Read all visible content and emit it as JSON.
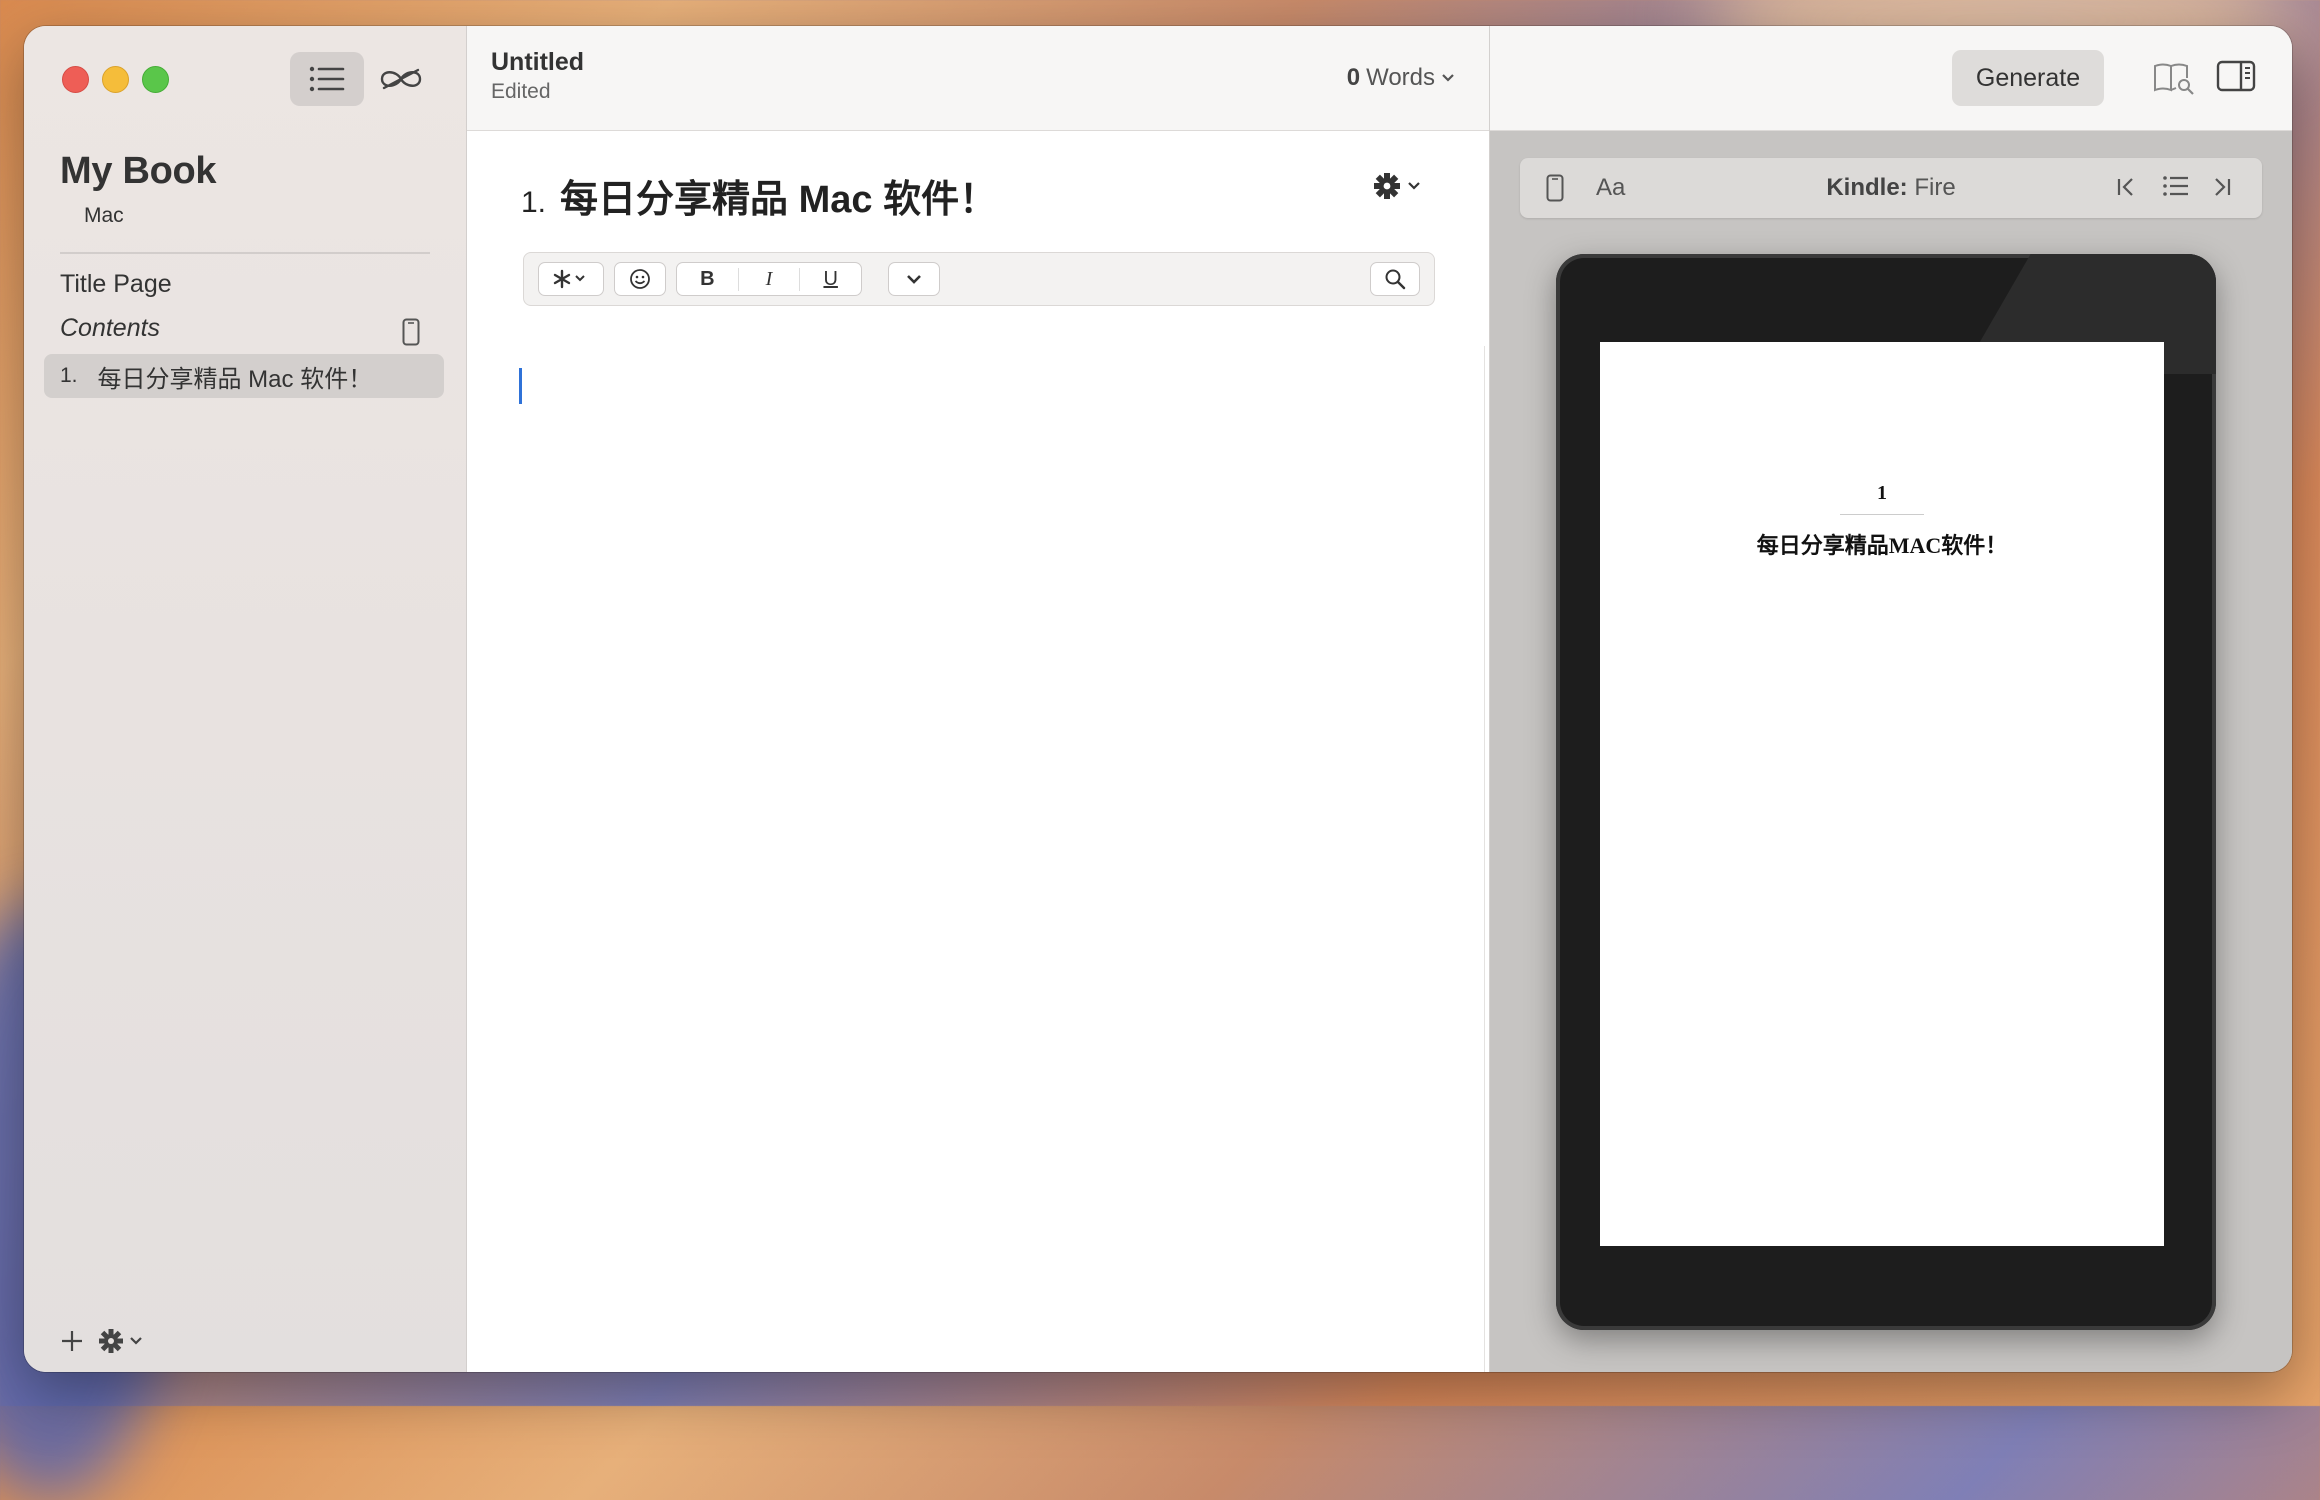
{
  "sidebar": {
    "book_title": "My Book",
    "book_author": "Mac",
    "title_page": "Title Page",
    "contents": "Contents",
    "chapters": [
      {
        "number": "1.",
        "title": "每日分享精品 Mac 软件！"
      }
    ]
  },
  "editor": {
    "doc_title": "Untitled",
    "doc_status": "Edited",
    "word_count": "0",
    "word_label": "Words",
    "chapter_number": "1.",
    "chapter_title": "每日分享精品 Mac 软件！",
    "format_bold": "B",
    "format_italic": "I",
    "format_underline": "U"
  },
  "preview": {
    "generate_label": "Generate",
    "font_label": "Aa",
    "device_brand": "Kindle:",
    "device_model": "Fire",
    "page_chapter_number": "1",
    "page_chapter_title": "每日分享精品MAC软件！"
  },
  "colors": {
    "accent_cursor": "#2f72d8",
    "close": "#ee5e56",
    "minimize": "#f5bd3a",
    "maximize": "#5ac64a"
  }
}
